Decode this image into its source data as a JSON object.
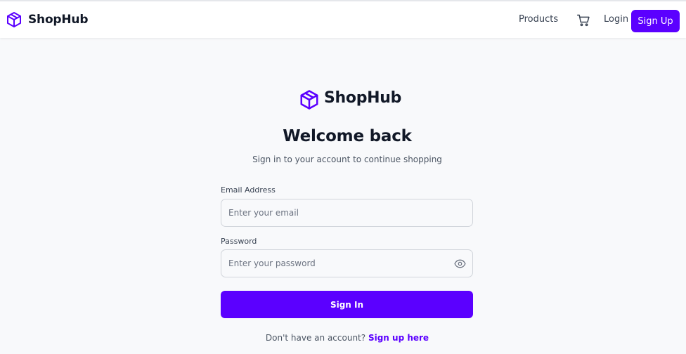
{
  "header": {
    "brand": "ShopHub",
    "logo_icon": "package-box-icon",
    "nav_products": "Products",
    "cart_icon": "shopping-cart-icon",
    "login": "Login",
    "signup": "Sign Up"
  },
  "main": {
    "brand": "ShopHub",
    "logo_icon": "package-box-icon",
    "title": "Welcome back",
    "subtitle": "Sign in to your account to continue shopping"
  },
  "form": {
    "email_label": "Email Address",
    "email_value": "",
    "email_placeholder": "Enter your email",
    "password_label": "Password",
    "password_value": "",
    "password_placeholder": "Enter your password",
    "password_toggle_icon": "eye-icon",
    "submit": "Sign In"
  },
  "footer": {
    "prompt": "Don't have an account?",
    "link": "Sign up here"
  },
  "colors": {
    "accent": "#5b00ff",
    "background": "#f8f9fb",
    "text_primary": "#111827",
    "text_secondary": "#4b5563",
    "border": "#d1d5db"
  }
}
